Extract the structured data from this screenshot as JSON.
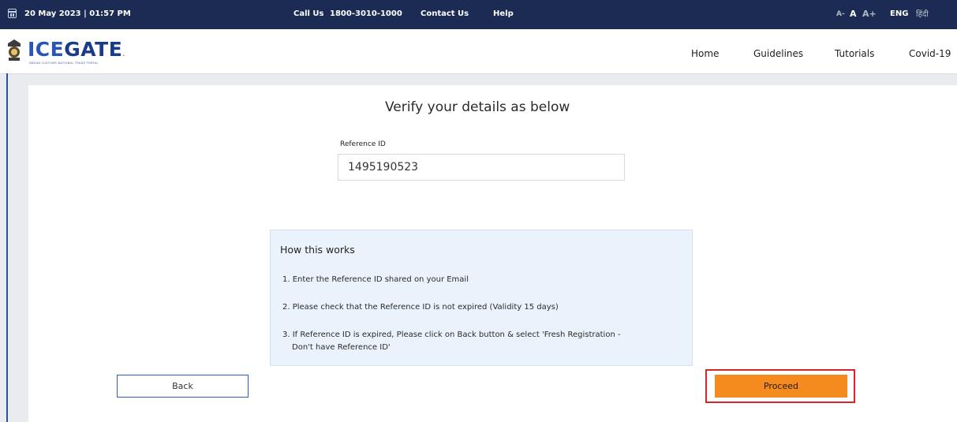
{
  "topbar": {
    "datetime": "20 May 2023 | 01:57 PM",
    "call_label": "Call Us",
    "call_number": "1800-3010-1000",
    "contact": "Contact Us",
    "help": "Help",
    "font_decrease": "A-",
    "font_normal": "A",
    "font_increase": "A+",
    "lang_eng": "ENG",
    "lang_hindi": "हिंदी"
  },
  "header": {
    "logo_ice": "ICE",
    "logo_gate": "GATE",
    "logo_tagline": "INDIAN CUSTOMS NATIONAL TRADE PORTAL",
    "nav": [
      "Home",
      "Guidelines",
      "Tutorials",
      "Covid-19"
    ]
  },
  "main": {
    "title": "Verify your details as below",
    "reference_label": "Reference ID",
    "reference_value": "1495190523"
  },
  "info": {
    "title": "How this works",
    "steps": [
      "1. Enter the Reference ID shared on your Email",
      "2. Please check that the Reference ID is not expired (Validity 15 days)",
      "3. If Reference ID is expired, Please click on Back button & select 'Fresh Registration -",
      "Don't have Reference ID'"
    ]
  },
  "buttons": {
    "back": "Back",
    "proceed": "Proceed"
  },
  "colors": {
    "topbar": "#1c2b53",
    "proceed": "#f58a1f",
    "highlight": "#d7262e",
    "info_bg": "#eaf2fb"
  }
}
